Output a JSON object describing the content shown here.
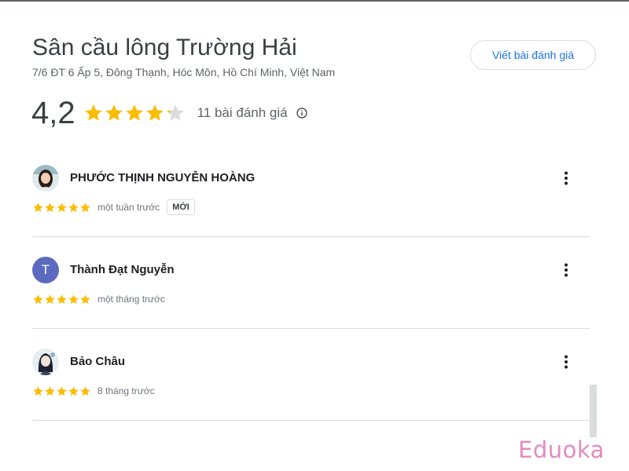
{
  "place": {
    "title": "Sân cầu lông Trường Hải",
    "address": "7/6 ĐT 6 Ấp 5, Đông Thạnh, Hóc Môn, Hồ Chí Minh, Việt Nam"
  },
  "write_review_label": "Viết bài đánh giá",
  "rating": {
    "value_text": "4,2",
    "value": 4.2,
    "max": 5,
    "count_text": "11 bài đánh giá"
  },
  "colors": {
    "star_filled": "#fbbc04",
    "star_empty": "#dadce0",
    "link_blue": "#1a73e8",
    "avatar_letter_bg": "#5c6bc0",
    "watermark": "#e48bc0"
  },
  "reviews": [
    {
      "name": "PHƯỚC THỊNH NGUYỄN HOÀNG",
      "avatar": "photo-avatar",
      "stars": 5,
      "time": "một tuần trước",
      "badge": "MỚI"
    },
    {
      "name": "Thành Đạt Nguyễn",
      "avatar": "letter-avatar",
      "avatar_letter": "T",
      "stars": 5,
      "time": "một tháng trước"
    },
    {
      "name": "Bảo Châu",
      "avatar": "photo-avatar",
      "stars": 5,
      "time": "8 tháng trước"
    }
  ],
  "watermark": "Eduoka"
}
